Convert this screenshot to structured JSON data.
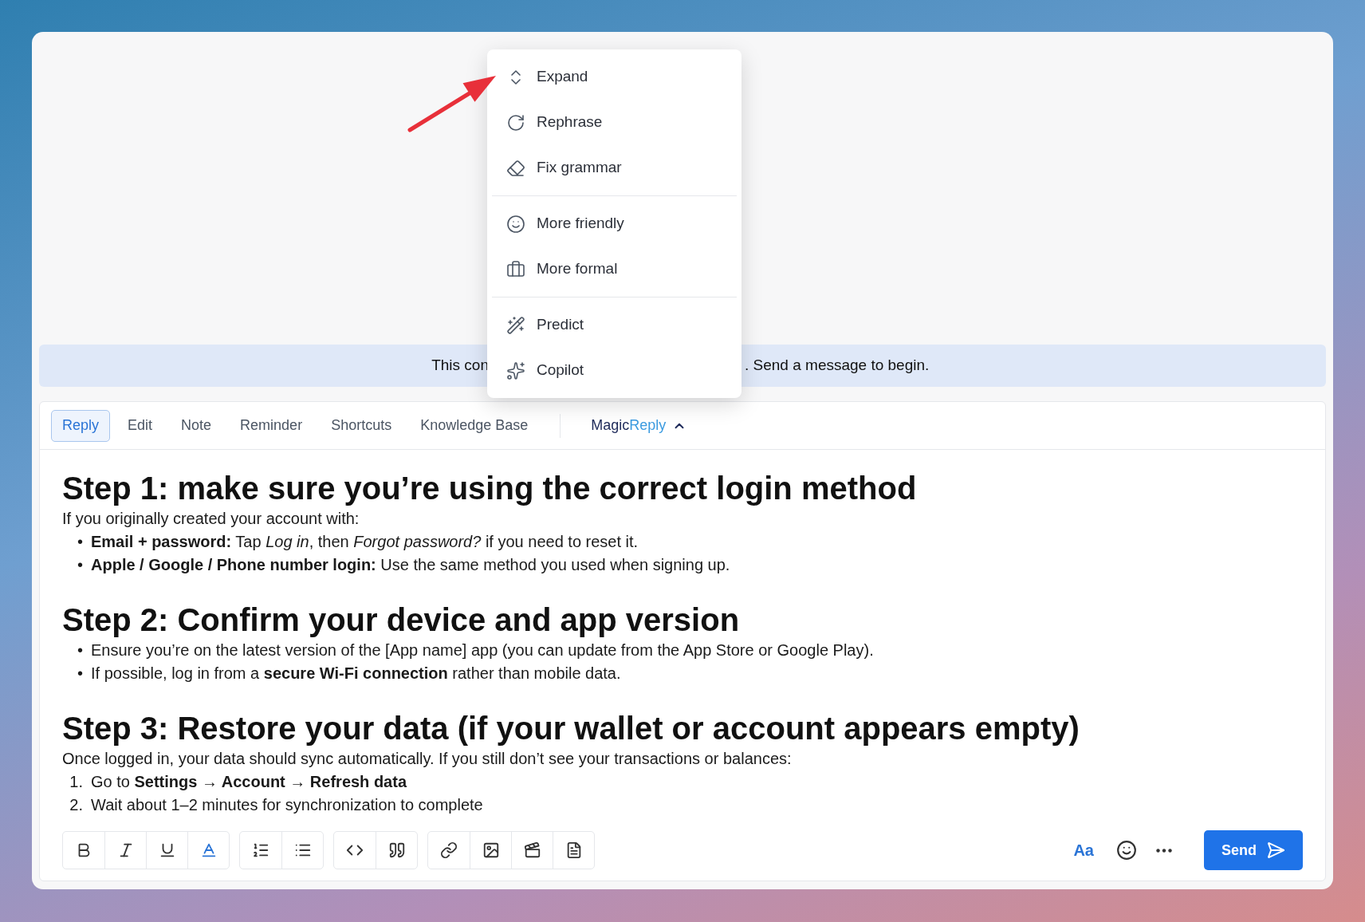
{
  "banner": {
    "text_left": "This con",
    "text_right": ". Send a message to begin."
  },
  "menu": {
    "groups": [
      [
        {
          "label": "Expand"
        },
        {
          "label": "Rephrase"
        },
        {
          "label": "Fix grammar"
        }
      ],
      [
        {
          "label": "More friendly"
        },
        {
          "label": "More formal"
        }
      ],
      [
        {
          "label": "Predict"
        },
        {
          "label": "Copilot"
        }
      ]
    ]
  },
  "tabs": [
    {
      "label": "Reply",
      "selected": true
    },
    {
      "label": "Edit",
      "selected": false
    },
    {
      "label": "Note",
      "selected": false
    },
    {
      "label": "Reminder",
      "selected": false
    },
    {
      "label": "Shortcuts",
      "selected": false
    },
    {
      "label": "Knowledge Base",
      "selected": false
    }
  ],
  "magic_reply": {
    "label": "Magic",
    "label_accent": "Reply",
    "expanded": true
  },
  "content": [
    {
      "kind": "heading",
      "text": "Step 1: make sure you’re using the correct login method"
    },
    {
      "kind": "paragraph",
      "text": "If you originally created your account with:"
    },
    {
      "kind": "list",
      "items": [
        {
          "marker": "•",
          "text": "**Email + password:** Tap *Log in*, then *Forgot password?* if you need to reset it."
        },
        {
          "marker": "•",
          "text": "**Apple / Google / Phone number login:** Use the same method you used when signing up."
        }
      ]
    },
    {
      "kind": "heading",
      "text": "Step 2: Confirm your device and app version"
    },
    {
      "kind": "list",
      "items": [
        {
          "marker": "•",
          "text": "Ensure you’re on the latest version of the [App name] app (you can update from the App Store or Google Play)."
        },
        {
          "marker": "•",
          "text": "If possible, log in from a **secure Wi-Fi connection** rather than mobile data."
        }
      ]
    },
    {
      "kind": "heading",
      "text": "Step 3: Restore your data (if your wallet or account appears empty)"
    },
    {
      "kind": "paragraph",
      "text": "Once logged in, your data should sync automatically. If you still don’t see your transactions or balances:"
    },
    {
      "kind": "list",
      "items": [
        {
          "marker": "1.",
          "text": "Go to **Settings → Account → Refresh data**"
        },
        {
          "marker": "2.",
          "text": "Wait about 1–2 minutes for synchronization to complete"
        }
      ]
    }
  ],
  "font_button": "Aa",
  "send_button": "Send"
}
